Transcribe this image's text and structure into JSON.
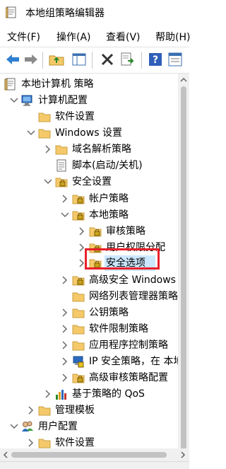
{
  "window": {
    "title": "本地组策略编辑器"
  },
  "menu": [
    {
      "label": "文件(F)"
    },
    {
      "label": "操作(A)"
    },
    {
      "label": "查看(V)"
    },
    {
      "label": "帮助(H)"
    }
  ],
  "toolbar": {
    "buttons": [
      "back-icon",
      "forward-icon",
      "up-folder-icon",
      "show-hide-tree-icon",
      "delete-icon",
      "export-list-icon",
      "help-icon",
      "properties-icon"
    ]
  },
  "tree": {
    "nodes": [
      {
        "label": "本地计算机 策略",
        "icon": "policy-document-icon",
        "expand": "none"
      },
      {
        "label": "计算机配置",
        "icon": "computer-icon",
        "expand": "expanded"
      },
      {
        "label": "软件设置",
        "icon": "folder-icon",
        "expand": "none"
      },
      {
        "label": "Windows 设置",
        "icon": "folder-icon",
        "expand": "expanded"
      },
      {
        "label": "域名解析策略",
        "icon": "folder-icon",
        "expand": "collapsed"
      },
      {
        "label": "脚本(启动/关机)",
        "icon": "script-icon",
        "expand": "none"
      },
      {
        "label": "安全设置",
        "icon": "security-settings-icon",
        "expand": "expanded"
      },
      {
        "label": "帐户策略",
        "icon": "locked-folder-icon",
        "expand": "collapsed"
      },
      {
        "label": "本地策略",
        "icon": "locked-folder-icon",
        "expand": "expanded"
      },
      {
        "label": "审核策略",
        "icon": "locked-folder-icon",
        "expand": "collapsed"
      },
      {
        "label": "用户权限分配",
        "icon": "locked-folder-icon",
        "expand": "collapsed"
      },
      {
        "label": "安全选项",
        "icon": "locked-folder-icon",
        "expand": "collapsed"
      },
      {
        "label": "高级安全 Windows Defender 防火墙",
        "icon": "locked-folder-icon",
        "expand": "collapsed"
      },
      {
        "label": "网络列表管理器策略",
        "icon": "folder-icon",
        "expand": "none"
      },
      {
        "label": "公钥策略",
        "icon": "folder-icon",
        "expand": "collapsed"
      },
      {
        "label": "软件限制策略",
        "icon": "folder-icon",
        "expand": "collapsed"
      },
      {
        "label": "应用程序控制策略",
        "icon": "folder-icon",
        "expand": "collapsed"
      },
      {
        "label": "IP 安全策略，在 本地计算机",
        "icon": "ip-security-icon",
        "expand": "collapsed"
      },
      {
        "label": "高级审核策略配置",
        "icon": "locked-folder-icon",
        "expand": "collapsed"
      },
      {
        "label": "基于策略的 QoS",
        "icon": "qos-chart-icon",
        "expand": "collapsed"
      },
      {
        "label": "管理模板",
        "icon": "folder-icon",
        "expand": "collapsed"
      },
      {
        "label": "用户配置",
        "icon": "user-icon",
        "expand": "expanded"
      },
      {
        "label": "软件设置",
        "icon": "folder-icon",
        "expand": "collapsed"
      }
    ],
    "selected": "安全选项"
  },
  "colors": {
    "selection": "#cce8ff",
    "highlight_box": "#e8202a",
    "folder": "#f5c96a"
  }
}
